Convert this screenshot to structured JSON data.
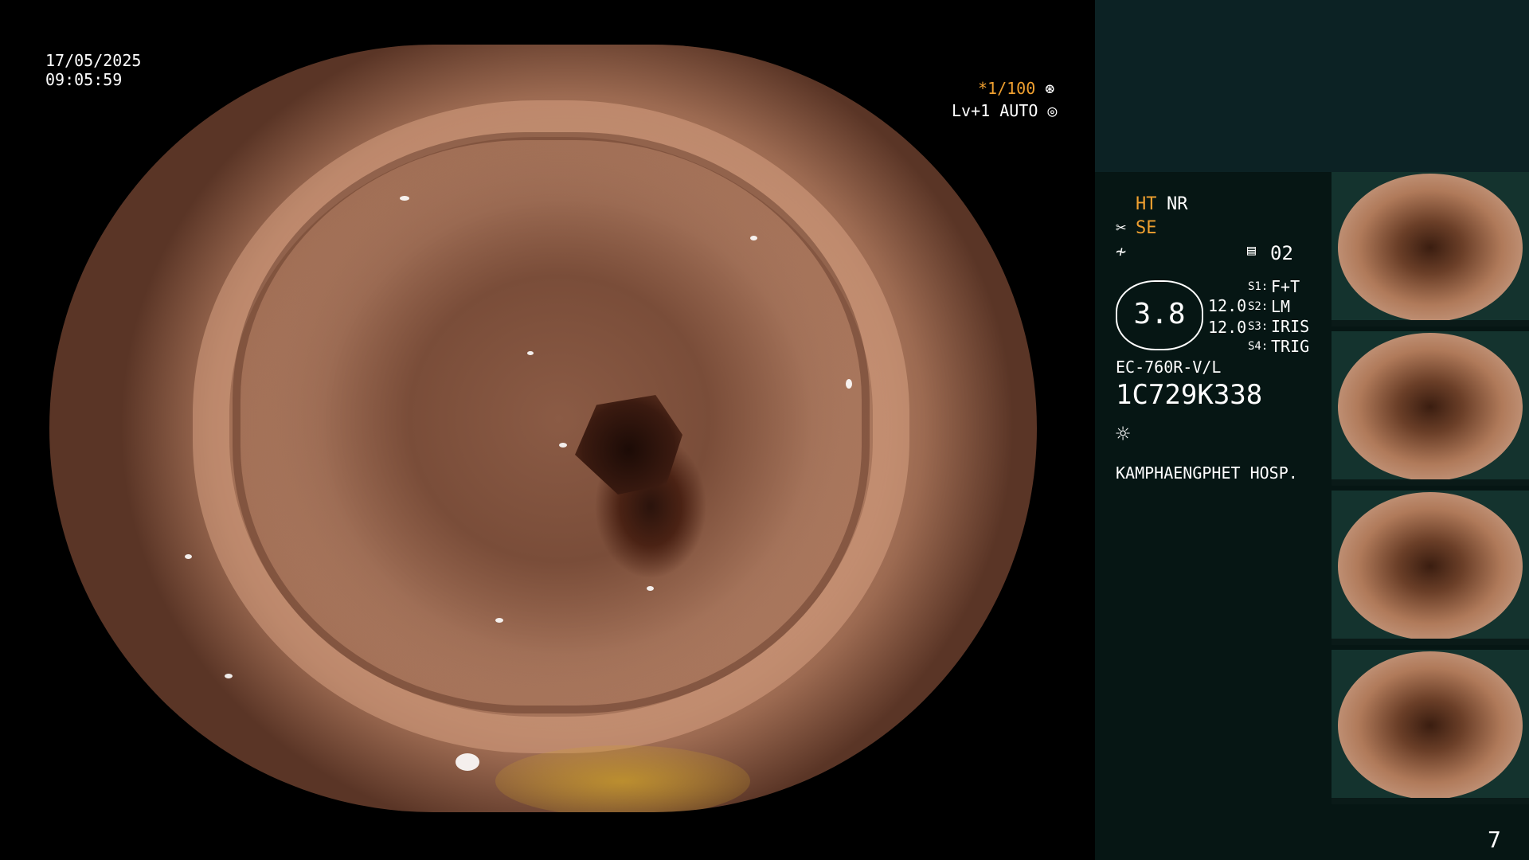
{
  "overlay": {
    "date": "17/05/2025",
    "time": "09:05:59",
    "shutter": "*1/100",
    "level": "Lv+1 AUTO"
  },
  "panel": {
    "ht": "HT",
    "nr": "NR",
    "se": "SE",
    "count": "02",
    "gauge_value": "3.8",
    "val1": "12.0",
    "val2": "12.0",
    "s1_key": "S1:",
    "s1": "F+T",
    "s2_key": "S2:",
    "s2": "LM",
    "s3_key": "S3:",
    "s3": "IRIS",
    "s4_key": "S4:",
    "s4": "TRIG",
    "scope_model": "EC-760R-V/L",
    "scope_serial": "1C729K338",
    "hospital": "KAMPHAENGPHET HOSP.",
    "page_number": "7"
  },
  "icons": [
    "aperture-icon",
    "iris-icon",
    "scissors-icon",
    "feather-icon",
    "memo-icon",
    "brightness-icon"
  ],
  "colors": {
    "accent": "#f0a030",
    "panel": "#061614",
    "panel_top": "#0c2224"
  }
}
